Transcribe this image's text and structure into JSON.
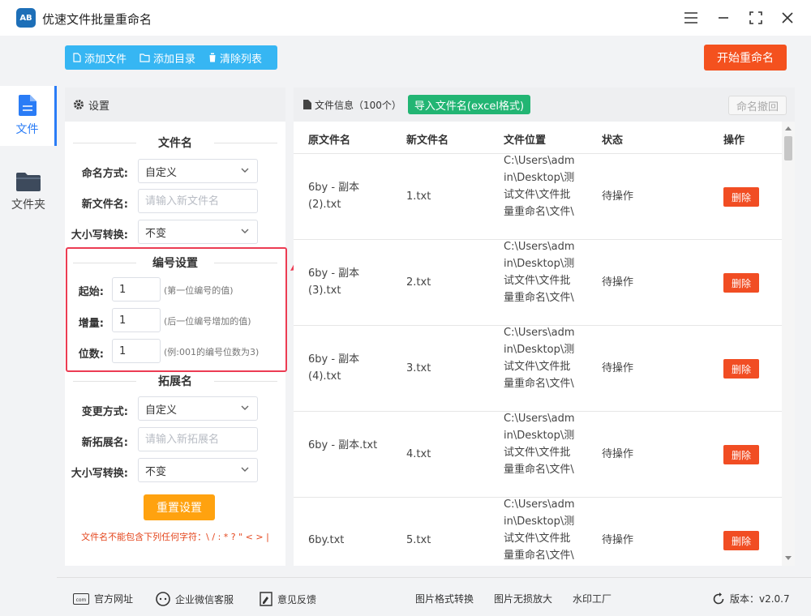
{
  "app": {
    "title": "优速文件批量重命名",
    "logo_text": "AB"
  },
  "window_controls": [
    "menu-icon",
    "minimize-icon",
    "maximize-icon",
    "close-icon"
  ],
  "nav": [
    {
      "label": "文件",
      "icon": "file-icon",
      "active": true
    },
    {
      "label": "文件夹",
      "icon": "folder-icon",
      "active": false
    }
  ],
  "toolbar": {
    "add_file": "添加文件",
    "add_dir": "添加目录",
    "clear_list": "清除列表",
    "start": "开始重命名"
  },
  "settings": {
    "header": "设置",
    "filename": {
      "title": "文件名",
      "mode_label": "命名方式:",
      "mode_value": "自定义",
      "new_name_label": "新文件名:",
      "new_name_placeholder": "请输入新文件名",
      "case_label": "大小写转换:",
      "case_value": "不变"
    },
    "numbering": {
      "title": "编号设置",
      "start_label": "起始:",
      "start_value": "1",
      "start_hint": "(第一位编号的值)",
      "step_label": "增量:",
      "step_value": "1",
      "step_hint": "(后一位编号增加的值)",
      "digits_label": "位数:",
      "digits_value": "1",
      "digits_hint": "(例:001的编号位数为3)"
    },
    "extension": {
      "title": "拓展名",
      "mode_label": "变更方式:",
      "mode_value": "自定义",
      "new_ext_label": "新拓展名:",
      "new_ext_placeholder": "请输入新拓展名",
      "case_label": "大小写转换:",
      "case_value": "不变"
    },
    "reset": "重置设置",
    "warning": "文件名不能包含下列任何字符：\\ / : * ? \" < > |"
  },
  "filelist": {
    "info": "文件信息（100个）",
    "import": "导入文件名(excel格式)",
    "undo": "命名撤回",
    "columns": {
      "old": "原文件名",
      "new": "新文件名",
      "location": "文件位置",
      "status": "状态",
      "action": "操作"
    },
    "rows": [
      {
        "old": "6by - 副本 (2).txt",
        "new": "1.txt",
        "location": "C:\\Users\\admin\\Desktop\\测试文件\\文件批量重命名\\文件\\",
        "status": "待操作",
        "action": "删除"
      },
      {
        "old": "6by - 副本 (3).txt",
        "new": "2.txt",
        "location": "C:\\Users\\admin\\Desktop\\测试文件\\文件批量重命名\\文件\\",
        "status": "待操作",
        "action": "删除"
      },
      {
        "old": "6by - 副本 (4).txt",
        "new": "3.txt",
        "location": "C:\\Users\\admin\\Desktop\\测试文件\\文件批量重命名\\文件\\",
        "status": "待操作",
        "action": "删除"
      },
      {
        "old": "6by - 副本.txt",
        "new": "4.txt",
        "location": "C:\\Users\\admin\\Desktop\\测试文件\\文件批量重命名\\文件\\",
        "status": "待操作",
        "action": "删除"
      },
      {
        "old": "6by.txt",
        "new": "5.txt",
        "location": "C:\\Users\\admin\\Desktop\\测试文件\\文件批量重命名\\文件\\",
        "status": "待操作",
        "action": "删除"
      }
    ]
  },
  "footer": {
    "website": "官方网址",
    "wechat": "企业微信客服",
    "feedback": "意见反馈",
    "img_convert": "图片格式转换",
    "img_enlarge": "图片无损放大",
    "watermark": "水印工厂",
    "version": "版本：v2.0.7"
  },
  "colors": {
    "accent": "#2a7cf6",
    "toolbar": "#36b6f3",
    "start": "#f4511e",
    "import": "#22b573",
    "reset": "#ffa20f",
    "delete": "#f14d23",
    "highlight": "#ec3c53"
  }
}
